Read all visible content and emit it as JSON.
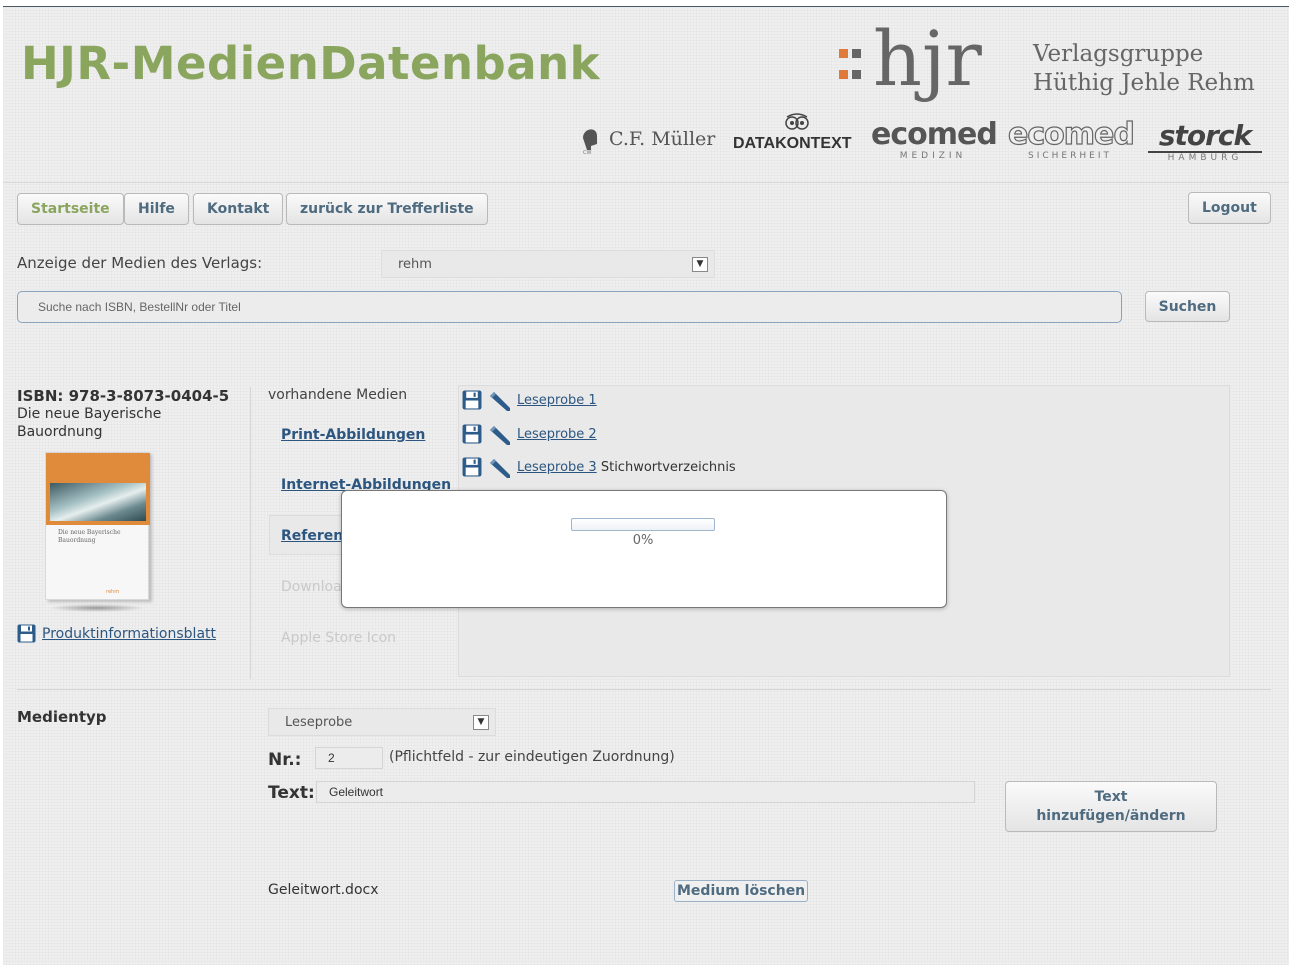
{
  "header": {
    "title": "HJR-MedienDatenbank",
    "group_logo_text": "hjr",
    "group_name_line1": "Verlagsgruppe",
    "group_name_line2": "Hüthig Jehle Rehm",
    "brands": {
      "cfmueller": "C.F. Müller",
      "datakontext": "DATAKONTEXT",
      "ecomed_medizin": "ecomed",
      "ecomed_medizin_sub": "MEDIZIN",
      "ecomed_sicherheit": "ecomed",
      "ecomed_sicherheit_sub": "SICHERHEIT",
      "storck": "storck",
      "storck_sub": "HAMBURG"
    }
  },
  "nav": {
    "home": "Startseite",
    "help": "Hilfe",
    "contact": "Kontakt",
    "back": "zurück zur Trefferliste",
    "logout": "Logout"
  },
  "publisher": {
    "label": "Anzeige der Medien des Verlags:",
    "selected": "rehm"
  },
  "search": {
    "placeholder": "Suche nach ISBN, BestellNr oder Titel",
    "button": "Suchen"
  },
  "product": {
    "isbn": "ISBN: 978-3-8073-0404-5",
    "title_line1": "Die neue Bayerische",
    "title_line2": "Bauordnung",
    "cover_title": "Die neue Bayerische Bauordnung",
    "cover_publisher": "rehm",
    "info_sheet": "Produktinformationsblatt"
  },
  "media_nav": {
    "heading": "vorhandene Medien",
    "print": "Print-Abbildungen",
    "internet": "Internet-Abbildungen",
    "references": "Referen",
    "downloads": "Downloa",
    "apple": "Apple Store Icon"
  },
  "media_list": [
    {
      "label": "Leseprobe 1",
      "extra": ""
    },
    {
      "label": "Leseprobe 2",
      "extra": ""
    },
    {
      "label": "Leseprobe 3",
      "extra": "Stichwortverzeichnis"
    }
  ],
  "progress": {
    "value": 0,
    "text": "0%"
  },
  "editor": {
    "type_label": "Medientyp",
    "type_selected": "Leseprobe",
    "nr_label": "Nr.:",
    "nr_value": "2",
    "nr_hint": "(Pflichtfeld - zur eindeutigen Zuordnung)",
    "text_label": "Text:",
    "text_value": "Geleitwort",
    "text_button_line1": "Text",
    "text_button_line2": "hinzufügen/ändern",
    "filename": "Geleitwort.docx",
    "delete_button": "Medium löschen"
  },
  "colors": {
    "title_green": "#8aa65e",
    "link_blue": "#2c5680",
    "button_text": "#4f6b80",
    "progress_fill": "#6d9ac7"
  }
}
